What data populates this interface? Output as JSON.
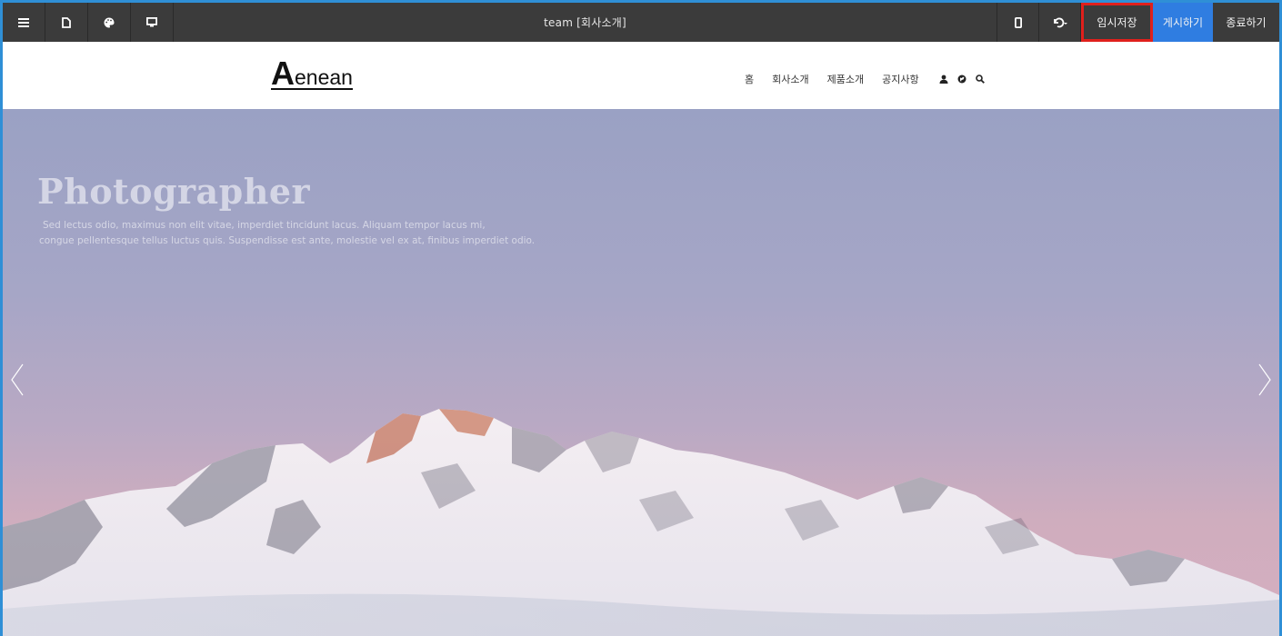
{
  "editor": {
    "title": "team [회사소개]",
    "buttons": {
      "temp_save": "임시저장",
      "publish": "게시하기",
      "exit": "종료하기"
    },
    "icons_left": [
      "menu-icon",
      "page-icon",
      "palette-icon",
      "desktop-icon"
    ],
    "icons_right": [
      "mobile-icon",
      "undo-icon"
    ]
  },
  "site": {
    "logo_initial": "A",
    "logo_rest": "enean",
    "nav": [
      "홈",
      "회사소개",
      "제품소개",
      "공지사항"
    ],
    "nav_icons": [
      "user-icon",
      "globe-icon",
      "search-icon"
    ]
  },
  "hero": {
    "title": "Photographer",
    "line1": "Sed lectus odio, maximus non elit vitae, imperdiet tincidunt lacus. Aliquam tempor lacus mi,",
    "line2": "congue pellentesque tellus luctus quis. Suspendisse est ante, molestie vel ex at, finibus imperdiet odio."
  },
  "colors": {
    "toolbar": "#3b3b3b",
    "publish": "#2f7de1",
    "highlight": "#e0201c"
  }
}
